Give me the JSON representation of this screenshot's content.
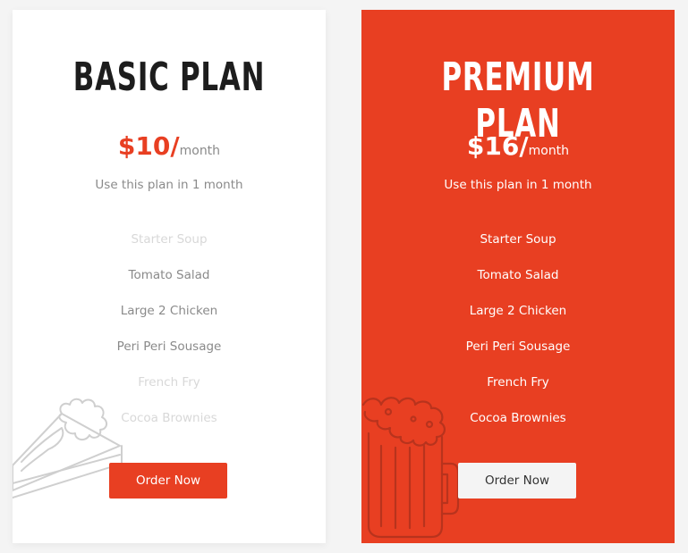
{
  "plans": [
    {
      "title": "BASIC PLAN",
      "price": "$10/",
      "period": "month",
      "description": "Use this plan in 1 month",
      "features": [
        {
          "label": "Starter Soup",
          "included": false
        },
        {
          "label": "Tomato Salad",
          "included": true
        },
        {
          "label": "Large 2 Chicken",
          "included": true
        },
        {
          "label": "Peri Peri Sousage",
          "included": true
        },
        {
          "label": "French Fry",
          "included": false
        },
        {
          "label": "Cocoa Brownies",
          "included": false
        }
      ],
      "button_label": "Order Now",
      "decoration_icon": "cake-slice-icon"
    },
    {
      "title": "PREMIUM PLAN",
      "price": "$16/",
      "period": "month",
      "description": "Use this plan in 1 month",
      "features": [
        {
          "label": "Starter Soup",
          "included": true
        },
        {
          "label": "Tomato Salad",
          "included": true
        },
        {
          "label": "Large 2 Chicken",
          "included": true
        },
        {
          "label": "Peri Peri Sousage",
          "included": true
        },
        {
          "label": "French Fry",
          "included": true
        },
        {
          "label": "Cocoa Brownies",
          "included": true
        }
      ],
      "button_label": "Order Now",
      "decoration_icon": "beer-mug-icon"
    }
  ],
  "colors": {
    "accent": "#e83f22",
    "page_background": "#f4f4f4",
    "card_background": "#ffffff",
    "muted_text": "#8a8a8a",
    "excluded_text": "#d8d8d8"
  }
}
